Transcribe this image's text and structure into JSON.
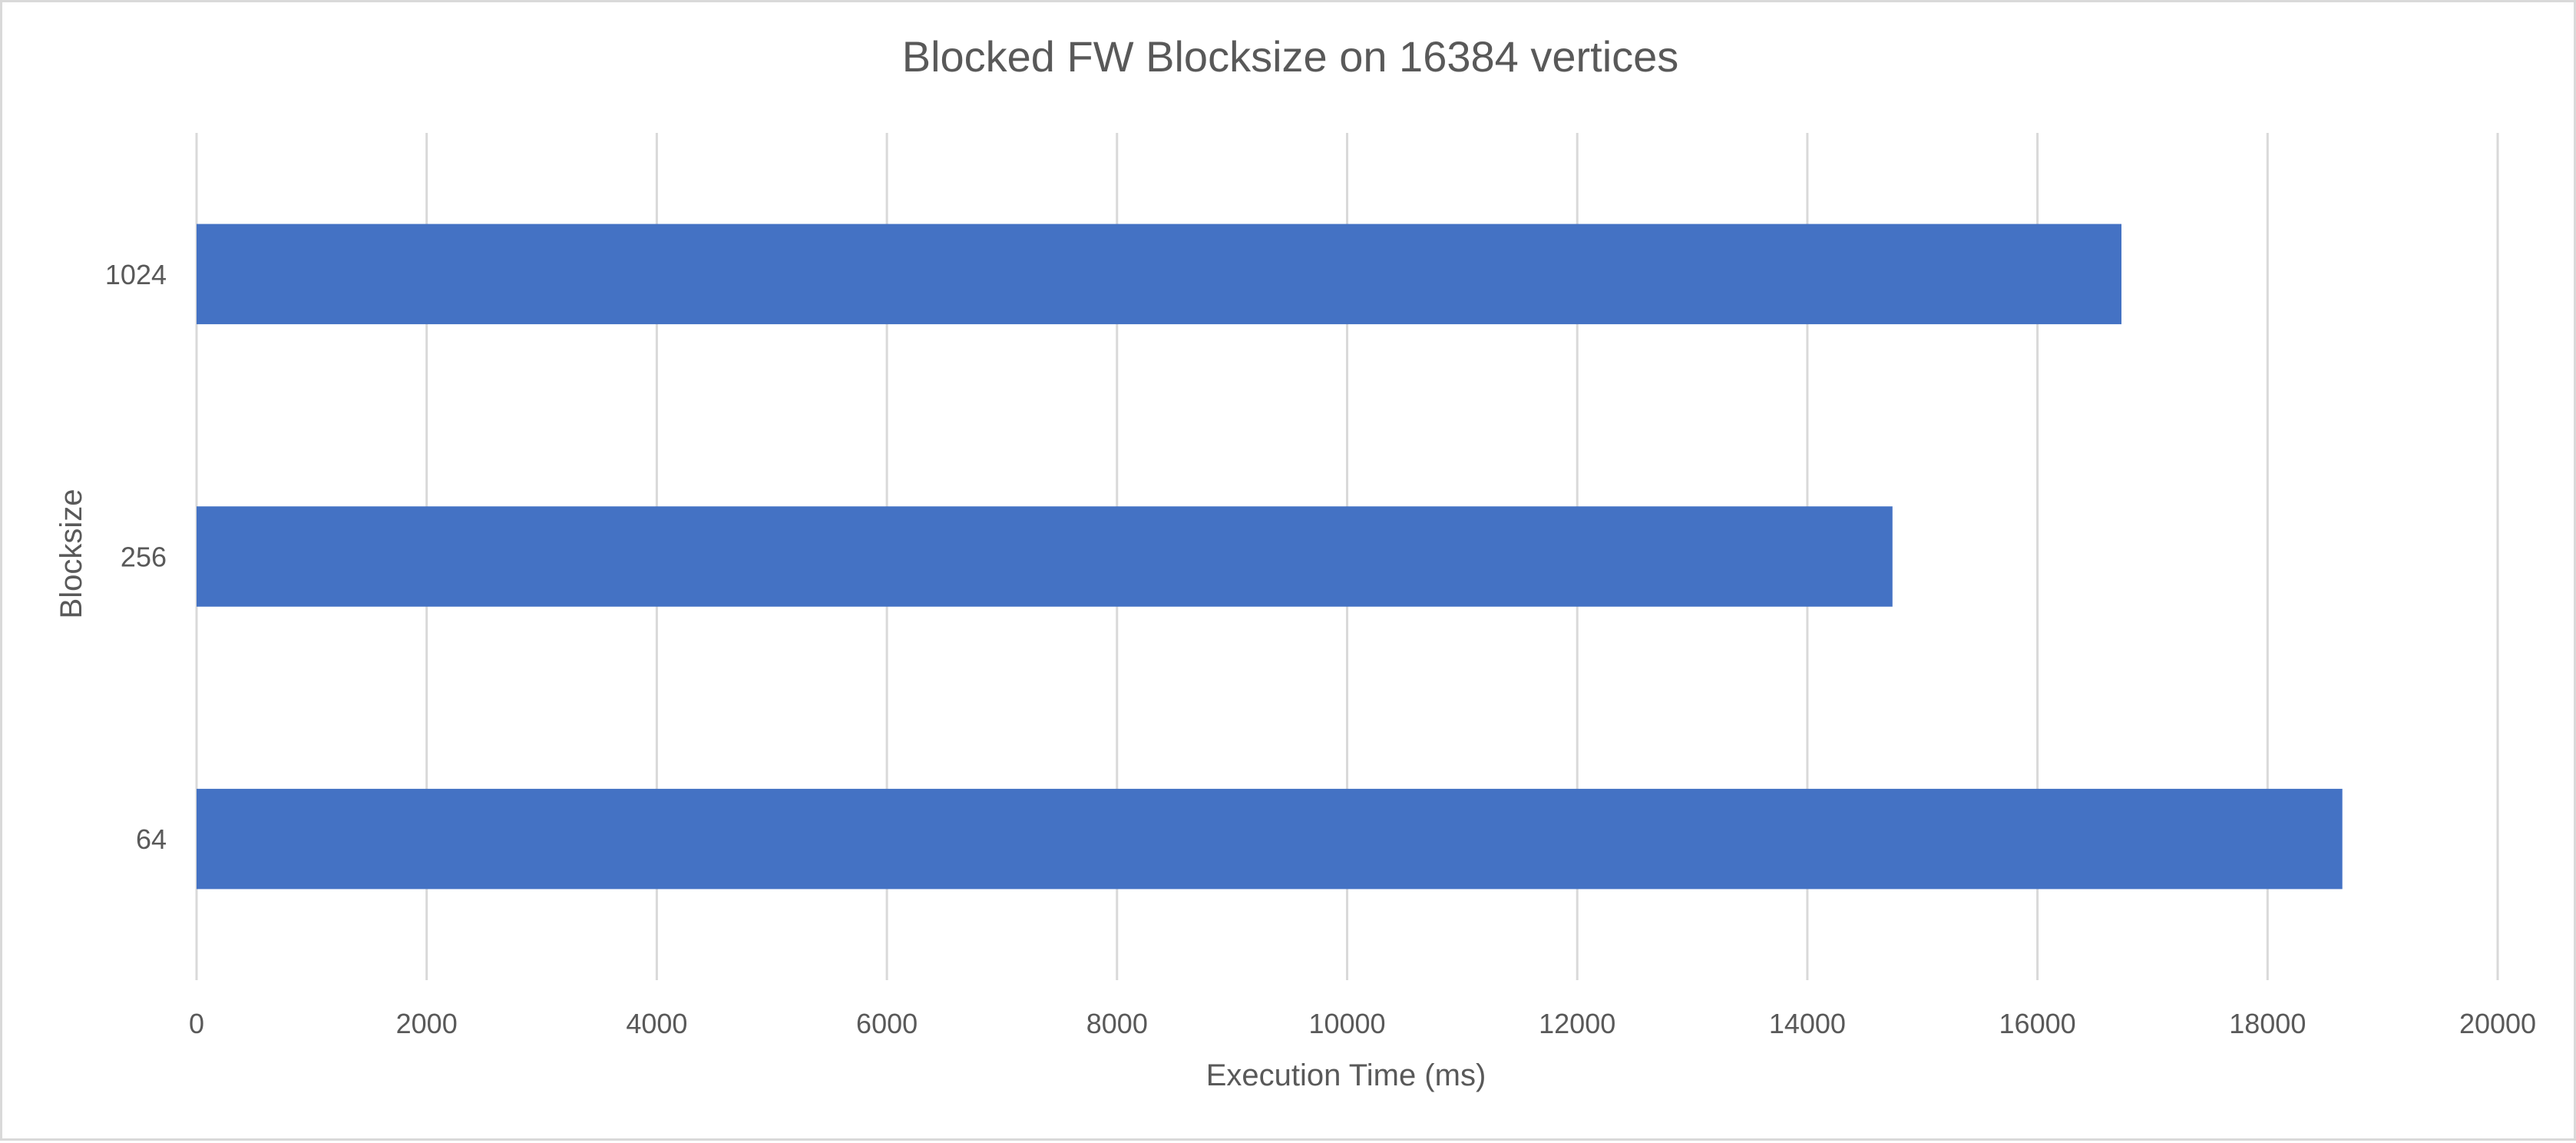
{
  "chart_data": {
    "type": "bar",
    "orientation": "horizontal",
    "title": "Blocked FW Blocksize on 16384 vertices",
    "xlabel": "Execution Time (ms)",
    "ylabel": "Blocksize",
    "categories": [
      "1024",
      "256",
      "64"
    ],
    "values": [
      16730,
      14740,
      18650
    ],
    "xlim": [
      0,
      20000
    ],
    "xticks": [
      "0",
      "2000",
      "4000",
      "6000",
      "8000",
      "10000",
      "12000",
      "14000",
      "16000",
      "18000",
      "20000"
    ],
    "grid": true,
    "legend": "none",
    "bar_color": "#4472C4"
  }
}
